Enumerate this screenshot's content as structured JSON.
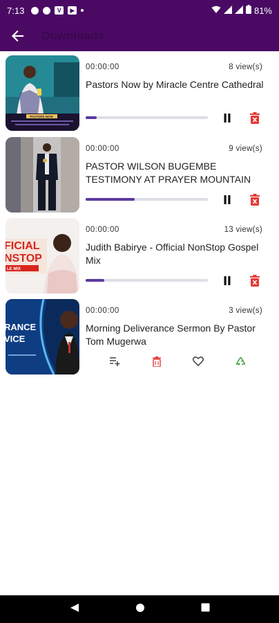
{
  "status_bar": {
    "time": "7:13",
    "battery": "81%",
    "icons": [
      "notification-circle-icon",
      "notification-circle-icon",
      "v-app-icon",
      "youtube-icon",
      "dot-icon",
      "wifi-icon",
      "signal-icon",
      "battery-icon"
    ]
  },
  "app_bar": {
    "title": "Downloads",
    "back_icon": "arrow-left-icon",
    "background": "#4a0a63"
  },
  "downloads": [
    {
      "time": "00:00:00",
      "views": "8 view(s)",
      "title": "Pastors Now by Miracle Centre Cathedral",
      "thumb_caption": "PASTORS NOW",
      "progress": 0.09,
      "state": "downloading"
    },
    {
      "time": "00:00:00",
      "views": "9 view(s)",
      "title": "PASTOR WILSON BUGEMBE TESTIMONY AT PRAYER MOUNTAIN",
      "progress": 0.4,
      "state": "downloading"
    },
    {
      "time": "00:00:00",
      "views": "13 view(s)",
      "title": "Judith Babirye - Official NonStop Gospel Mix",
      "thumb_lines": [
        "FICIAL",
        "NSTOP",
        "LE MIX"
      ],
      "progress": 0.15,
      "state": "downloading"
    },
    {
      "time": "00:00:00",
      "views": "3 view(s)",
      "title": "Morning Deliverance Sermon By Pastor Tom Mugerwa",
      "thumb_lines": [
        "RANCE",
        "VICE"
      ],
      "progress": 1,
      "state": "completed"
    }
  ],
  "colors": {
    "accent": "#5b3aa0",
    "delete": "#e53935",
    "share": "#43a047"
  },
  "icons": {
    "pause": "pause-icon",
    "delete": "trash-icon",
    "add_to_playlist": "playlist-add-icon",
    "favorite": "heart-outline-icon",
    "share": "recycle-icon"
  }
}
